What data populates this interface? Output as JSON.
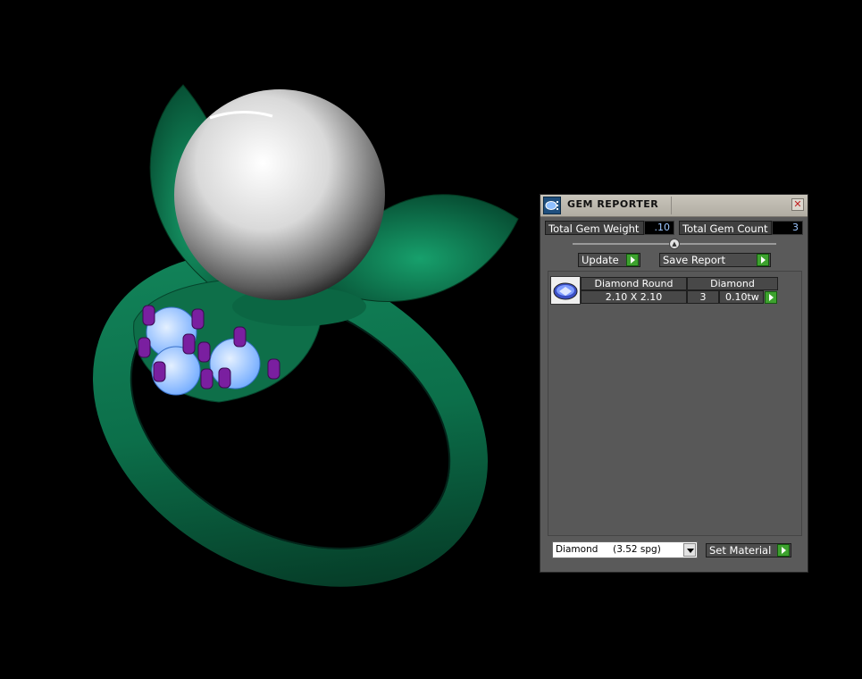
{
  "viewport": {
    "scene": "ring-3d-model",
    "colors": {
      "band": "#0f7a52",
      "pearl": "#e0e0e0",
      "gems": "#8fc0ff",
      "prongs": "#7a1fa0"
    }
  },
  "gem_reporter": {
    "title": "GEM REPORTER",
    "close_icon": "close-icon",
    "total_weight_label": "Total Gem Weight",
    "total_weight_value": ".10",
    "total_count_label": "Total Gem Count",
    "total_count_value": "3",
    "update_label": "Update",
    "save_report_label": "Save Report",
    "report": {
      "rows": [
        {
          "icon": "diamond-gem-icon",
          "cut": "Diamond Round",
          "material": "Diamond",
          "size": "2.10 X 2.10",
          "count": "3",
          "weight": "0.10tw"
        }
      ]
    },
    "material_select_value": "Diamond     (3.52 spg)",
    "set_material_label": "Set Material",
    "accent_color": "#3da22e"
  }
}
